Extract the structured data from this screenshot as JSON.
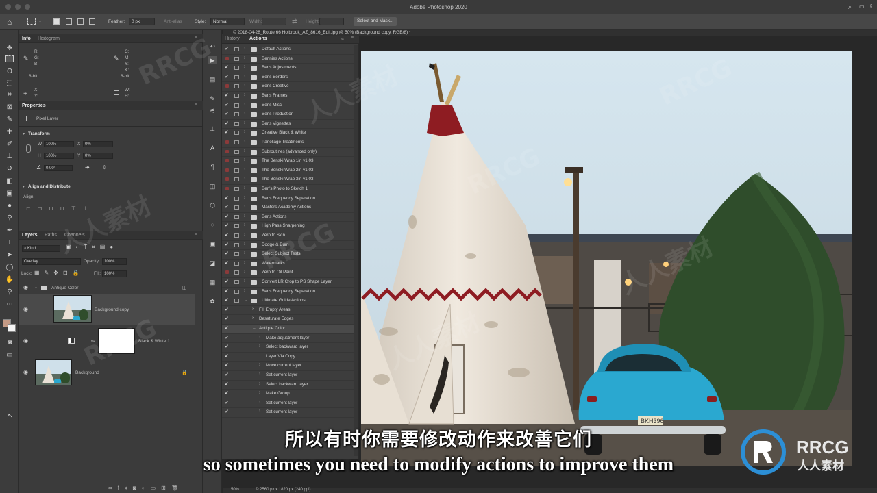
{
  "app": {
    "title": "Adobe Photoshop 2020"
  },
  "options_bar": {
    "feather_label": "Feather:",
    "feather_value": "0 px",
    "anti_alias_label": "Anti-alias",
    "style_label": "Style:",
    "style_value": "Normal",
    "width_label": "Width:",
    "height_label": "Height:",
    "select_mask_label": "Select and Mask..."
  },
  "info_panel": {
    "tabs": [
      "Info",
      "Histogram"
    ],
    "rgb_labels": [
      "R:",
      "G:",
      "B:"
    ],
    "cmyk_labels": [
      "C:",
      "M:",
      "Y:",
      "K:"
    ],
    "bit_left": "8-bit",
    "bit_right": "8-bit",
    "xy_labels": [
      "X:",
      "Y:"
    ],
    "wh_labels": [
      "W:",
      "H:"
    ]
  },
  "properties_panel": {
    "title": "Properties",
    "pixel_layer_label": "Pixel Layer",
    "transform_label": "Transform",
    "w_label": "W",
    "w_value": "100%",
    "x_label": "X",
    "x_value": "0%",
    "h_label": "H",
    "h_value": "100%",
    "y_label": "Y",
    "y_value": "0%",
    "angle_value": "0.00°",
    "align_distribute_label": "Align and Distribute",
    "align_label": "Align:"
  },
  "layers_panel": {
    "tabs": [
      "Layers",
      "Paths",
      "Channels"
    ],
    "kind_label": "Kind",
    "blend_mode": "Overlay",
    "opacity_label": "Opacity:",
    "opacity_value": "100%",
    "lock_label": "Lock:",
    "fill_label": "Fill:",
    "fill_value": "100%",
    "layers": [
      {
        "name": "Antique Color"
      },
      {
        "name": "Background copy"
      },
      {
        "name": "Black & White 1"
      },
      {
        "name": "Background"
      }
    ]
  },
  "actions_panel": {
    "tabs": [
      "History",
      "Actions"
    ],
    "items": [
      {
        "label": "Default Actions",
        "indent": 0,
        "type": "set",
        "red": false
      },
      {
        "label": "Bennies Actions",
        "indent": 0,
        "type": "set",
        "red": true
      },
      {
        "label": "Bens Adjustments",
        "indent": 0,
        "type": "set",
        "red": false
      },
      {
        "label": "Bens Borders",
        "indent": 0,
        "type": "set",
        "red": false
      },
      {
        "label": "Bens Creative",
        "indent": 0,
        "type": "set",
        "red": true
      },
      {
        "label": "Bens Frames",
        "indent": 0,
        "type": "set",
        "red": false
      },
      {
        "label": "Bens Misc",
        "indent": 0,
        "type": "set",
        "red": false
      },
      {
        "label": "Bens Production",
        "indent": 0,
        "type": "set",
        "red": false
      },
      {
        "label": "Bens Vignettes",
        "indent": 0,
        "type": "set",
        "red": false
      },
      {
        "label": "Creative Black & White",
        "indent": 0,
        "type": "set",
        "red": false
      },
      {
        "label": "Panoliage Treatments",
        "indent": 0,
        "type": "set",
        "red": true
      },
      {
        "label": "Subroutines (advanced only)",
        "indent": 0,
        "type": "set",
        "red": true
      },
      {
        "label": "The Benski Wrap 1in v1.03",
        "indent": 0,
        "type": "set",
        "red": true
      },
      {
        "label": "The Benski Wrap 2in v1.03",
        "indent": 0,
        "type": "set",
        "red": true
      },
      {
        "label": "The Benski Wrap 3in v1.03",
        "indent": 0,
        "type": "set",
        "red": true
      },
      {
        "label": "Ben's Photo to Sketch 1",
        "indent": 0,
        "type": "set",
        "red": true
      },
      {
        "label": "Bens Frequency Separation",
        "indent": 0,
        "type": "set",
        "red": false
      },
      {
        "label": "Masters Academy Actions",
        "indent": 0,
        "type": "set",
        "red": false
      },
      {
        "label": "Bens Actions",
        "indent": 0,
        "type": "set",
        "red": false
      },
      {
        "label": "High Pass Sharpening",
        "indent": 0,
        "type": "set",
        "red": false
      },
      {
        "label": "Zero to Skin",
        "indent": 0,
        "type": "set",
        "red": false
      },
      {
        "label": "Dodge & Burn",
        "indent": 0,
        "type": "set",
        "red": false
      },
      {
        "label": "Select Subject Tests",
        "indent": 0,
        "type": "set",
        "red": false
      },
      {
        "label": "Watermarks",
        "indent": 0,
        "type": "set",
        "red": false
      },
      {
        "label": "Zero to Oil Paint",
        "indent": 0,
        "type": "set",
        "red": true
      },
      {
        "label": "Convert LR Crop to PS Shape Layer",
        "indent": 0,
        "type": "set",
        "red": false
      },
      {
        "label": "Bens Frequency Separation",
        "indent": 0,
        "type": "set",
        "red": false
      },
      {
        "label": "Ultimate Guide Actions",
        "indent": 0,
        "type": "set-open",
        "red": false
      },
      {
        "label": "Fill Empty Areas",
        "indent": 1,
        "type": "action",
        "red": false
      },
      {
        "label": "Desaturate Edges",
        "indent": 1,
        "type": "action",
        "red": false
      },
      {
        "label": "Antique Color",
        "indent": 1,
        "type": "action-open",
        "red": false,
        "selected": true
      },
      {
        "label": "Make adjustment layer",
        "indent": 2,
        "type": "step",
        "red": false
      },
      {
        "label": "Select backward layer",
        "indent": 2,
        "type": "step",
        "red": false
      },
      {
        "label": "Layer Via Copy",
        "indent": 2,
        "type": "step-noarrow",
        "red": false
      },
      {
        "label": "Move current layer",
        "indent": 2,
        "type": "step",
        "red": false
      },
      {
        "label": "Set current layer",
        "indent": 2,
        "type": "step",
        "red": false
      },
      {
        "label": "Select backward layer",
        "indent": 2,
        "type": "step",
        "red": false
      },
      {
        "label": "Make Group",
        "indent": 2,
        "type": "step",
        "red": false
      },
      {
        "label": "Set current layer",
        "indent": 2,
        "type": "step",
        "red": false
      },
      {
        "label": "Set current layer",
        "indent": 2,
        "type": "step",
        "red": false
      }
    ]
  },
  "document": {
    "tab_title": "© 2018-04-28_Route 66 Holbrook_AZ_8616_Edit.jpg @ 50% (Background copy, RGB/8) *",
    "zoom": "50%",
    "doc_size": "© 2560 px x 1820 px (240 ppi)"
  },
  "subtitles": {
    "chinese": "所以有时你需要修改动作来改善它们",
    "english": "so sometimes you need to modify actions to improve them"
  },
  "watermark": {
    "brand": "RRCG",
    "cn_brand": "人人素材"
  },
  "colors": {
    "sky": "#cfe0ea",
    "teepee": "#e9e1d6",
    "teepee_red": "#8e1c22",
    "car": "#2aa8d0",
    "tree": "#2f4d2b"
  }
}
